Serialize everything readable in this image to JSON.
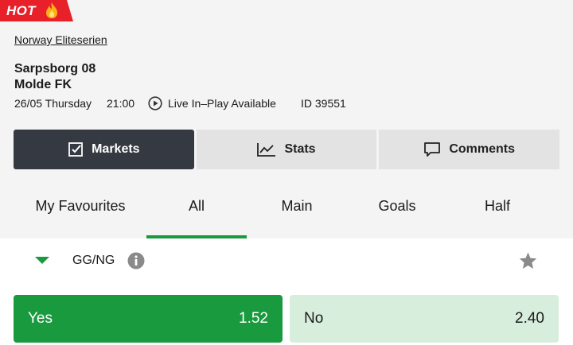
{
  "badge": {
    "label": "HOT",
    "icon": "flame-icon"
  },
  "match": {
    "league": "Norway Eliteserien",
    "home_team": "Sarpsborg 08",
    "away_team": "Molde FK",
    "date": "26/05 Thursday",
    "time": "21:00",
    "live_label": "Live In–Play Available",
    "id_label": "ID 39551"
  },
  "view_tabs": [
    {
      "label": "Markets",
      "icon": "checkbox-icon",
      "active": true
    },
    {
      "label": "Stats",
      "icon": "chart-icon",
      "active": false
    },
    {
      "label": "Comments",
      "icon": "comment-icon",
      "active": false
    }
  ],
  "market_tabs": [
    {
      "label": "My Favourites",
      "active": false
    },
    {
      "label": "All",
      "active": true
    },
    {
      "label": "Main",
      "active": false
    },
    {
      "label": "Goals",
      "active": false
    },
    {
      "label": "Half",
      "active": false
    }
  ],
  "market": {
    "title": "GG/NG",
    "outcomes": [
      {
        "label": "Yes",
        "odds": "1.52",
        "selected": true
      },
      {
        "label": "No",
        "odds": "2.40",
        "selected": false
      }
    ]
  },
  "colors": {
    "accent": "#1a9a3e",
    "badge": "#e8202a",
    "active_tab": "#353a42",
    "odd_unselected": "#d8eedd"
  }
}
